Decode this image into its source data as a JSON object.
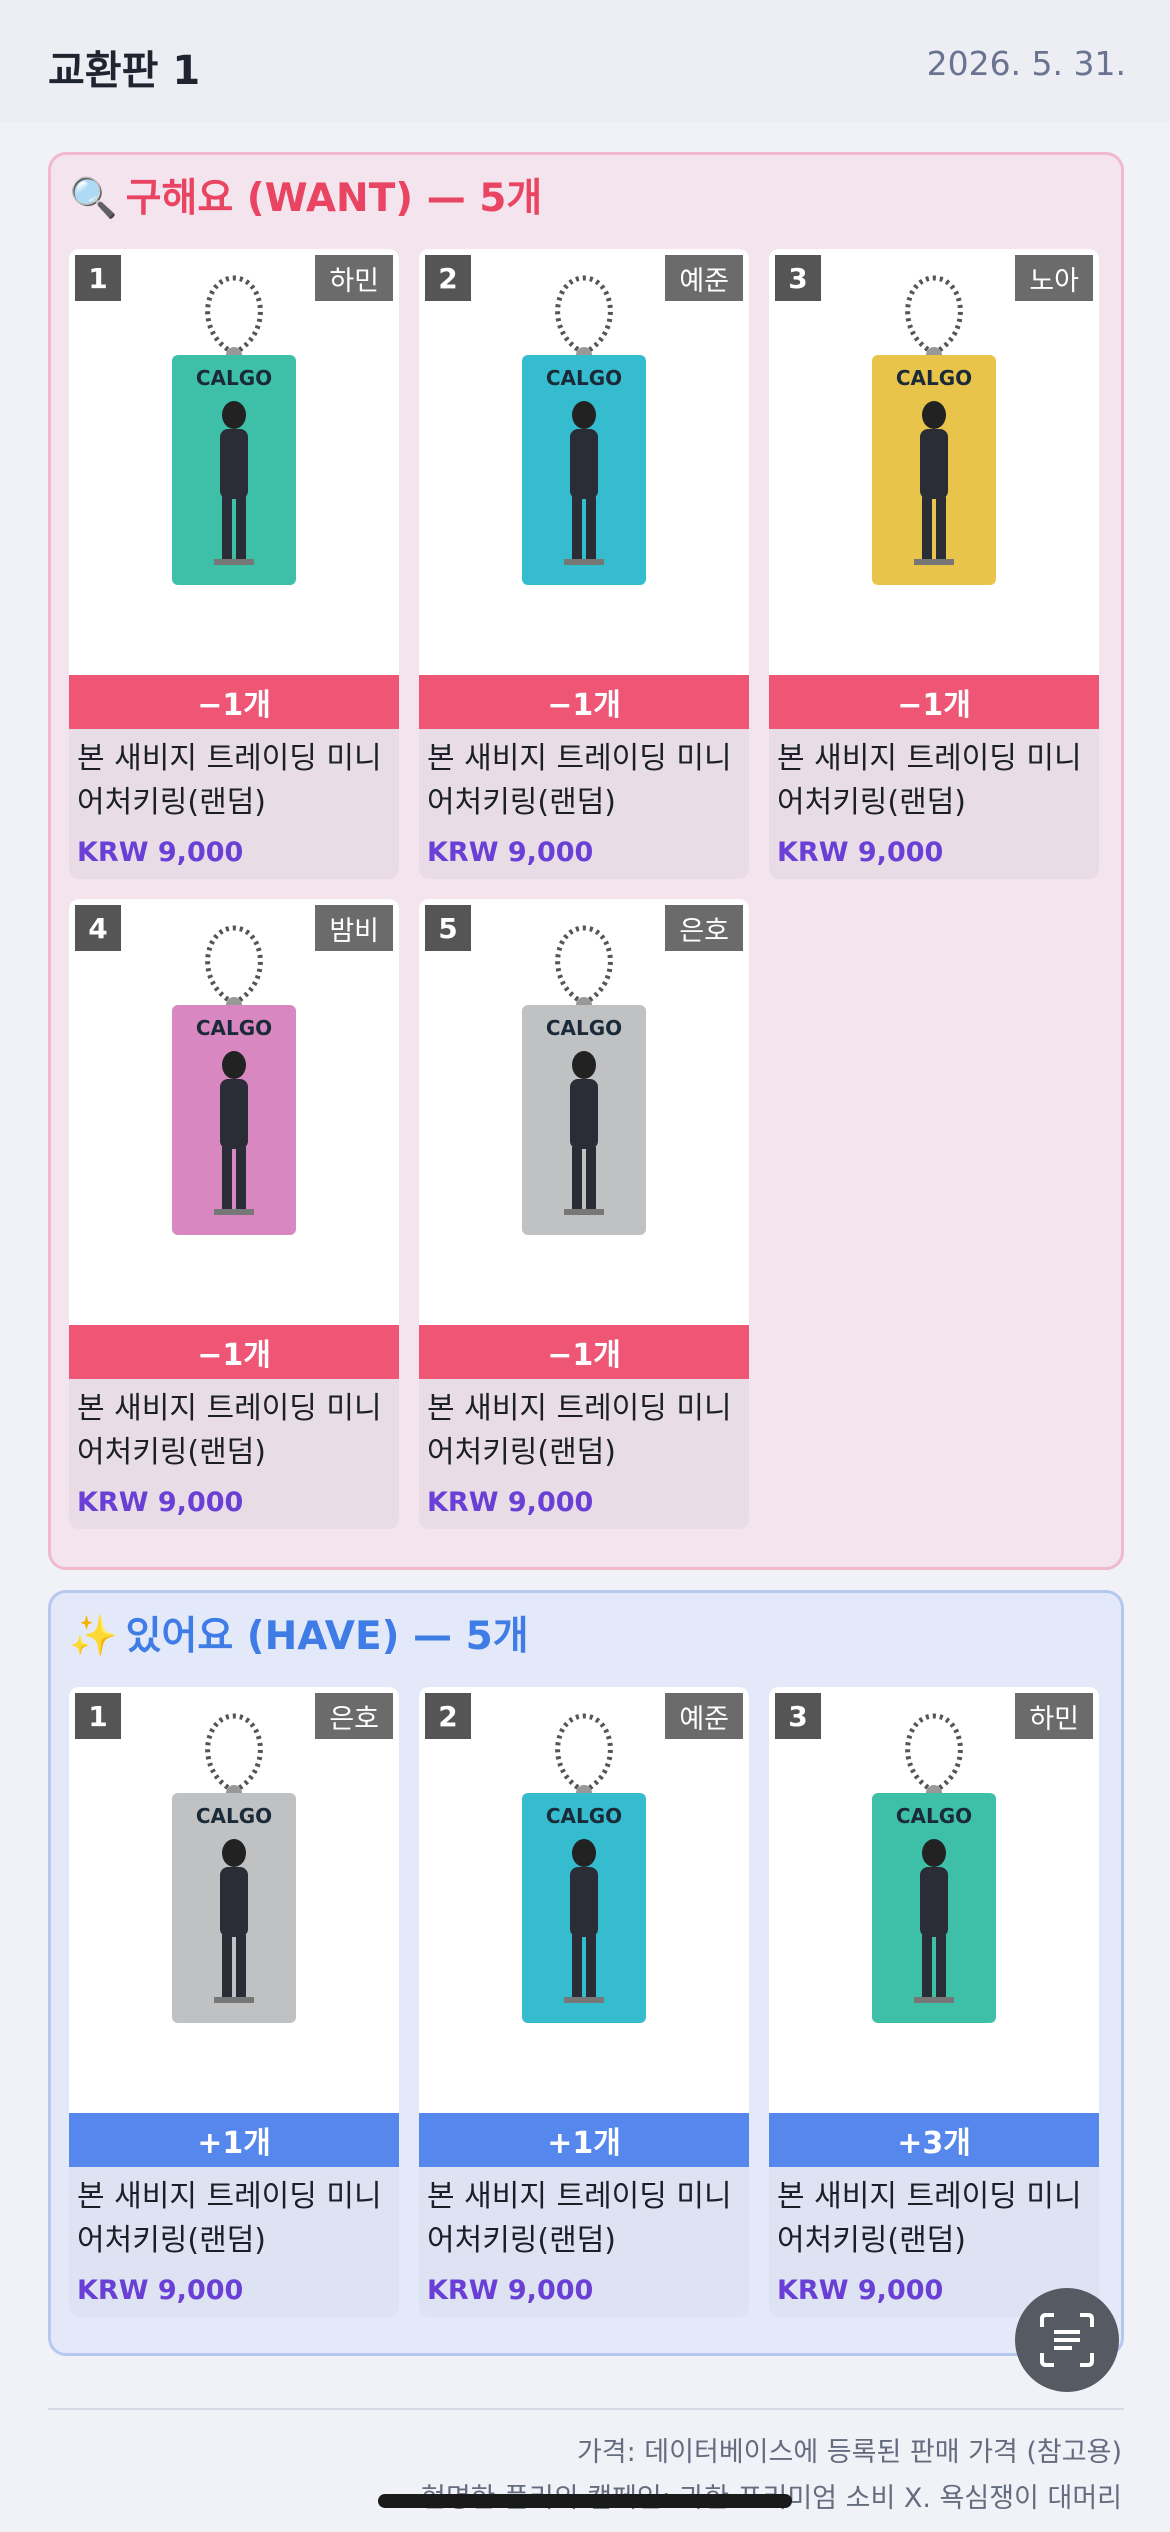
{
  "header": {
    "title": "교환판 1",
    "date": "2026. 5. 31."
  },
  "want": {
    "emoji": "🔍",
    "title": "구해요 (WANT) — 5개",
    "accent": "#ef5676",
    "items": [
      {
        "num": "1",
        "member": "하민",
        "qty": "−1개",
        "name": "본 새비지 트레이딩 미니 어처키링(랜덤)",
        "price": "KRW 9,000",
        "color": "#3dbfa8"
      },
      {
        "num": "2",
        "member": "예준",
        "qty": "−1개",
        "name": "본 새비지 트레이딩 미니 어처키링(랜덤)",
        "price": "KRW 9,000",
        "color": "#35bccf"
      },
      {
        "num": "3",
        "member": "노아",
        "qty": "−1개",
        "name": "본 새비지 트레이딩 미니 어처키링(랜덤)",
        "price": "KRW 9,000",
        "color": "#e9c44a"
      },
      {
        "num": "4",
        "member": "밤비",
        "qty": "−1개",
        "name": "본 새비지 트레이딩 미니 어처키링(랜덤)",
        "price": "KRW 9,000",
        "color": "#d887c0"
      },
      {
        "num": "5",
        "member": "은호",
        "qty": "−1개",
        "name": "본 새비지 트레이딩 미니 어처키링(랜덤)",
        "price": "KRW 9,000",
        "color": "#bfc1c3"
      }
    ]
  },
  "have": {
    "emoji": "✨",
    "title": "있어요 (HAVE) — 5개",
    "accent": "#5687ec",
    "items": [
      {
        "num": "1",
        "member": "은호",
        "qty": "+1개",
        "name": "본 새비지 트레이딩 미니 어처키링(랜덤)",
        "price": "KRW 9,000",
        "color": "#bfc1c3"
      },
      {
        "num": "2",
        "member": "예준",
        "qty": "+1개",
        "name": "본 새비지 트레이딩 미니 어처키링(랜덤)",
        "price": "KRW 9,000",
        "color": "#35bccf"
      },
      {
        "num": "3",
        "member": "하민",
        "qty": "+3개",
        "name": "본 새비지 트레이딩 미니 어처키링(랜덤)",
        "price": "KRW 9,000",
        "color": "#3dbfa8"
      }
    ]
  },
  "keyring": {
    "logo": "CALGO"
  },
  "footer": {
    "price_note": "가격: 데이터베이스에 등록된 판매 가격 (참고용)",
    "campaign_note": "현명한 플리의 캠페인: 과한 프리미엄 소비 X. 욕심쟁이 대머리"
  },
  "icons": {
    "scan": "scan-text-icon"
  }
}
